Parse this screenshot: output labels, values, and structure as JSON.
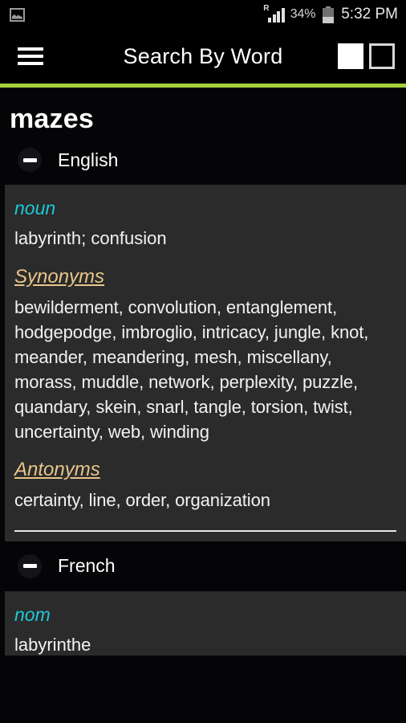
{
  "status_bar": {
    "notification_icon": "image-notification-icon",
    "roaming_indicator": "R",
    "signal_icon": "signal-bars-icon",
    "battery_percent": "34%",
    "battery_icon": "battery-icon",
    "time": "5:32 PM"
  },
  "app_bar": {
    "menu_icon": "hamburger-menu-icon",
    "title": "Search By Word",
    "action_filled": "filled-square-button",
    "action_outline": "outlined-square-button",
    "accent_color": "#a7d13a"
  },
  "entry": {
    "word": "mazes"
  },
  "sections": [
    {
      "language": "English",
      "collapse_icon": "minus-icon",
      "part_of_speech": "noun",
      "definition": "labyrinth; confusion",
      "synonyms_label": "Synonyms",
      "synonyms": "bewilderment, convolution, entanglement, hodgepodge, imbroglio, intricacy, jungle, knot, meander, meandering, mesh, miscellany, morass, muddle, network, perplexity, puzzle, quandary, skein, snarl, tangle, torsion, twist, uncertainty, web, winding",
      "antonyms_label": "Antonyms",
      "antonyms": "certainty, line, order, organization"
    },
    {
      "language": "French",
      "collapse_icon": "minus-icon",
      "part_of_speech": "nom",
      "definition": "labyrinthe"
    }
  ],
  "colors": {
    "page_background": "#050508",
    "card_background": "#2b2b2b",
    "part_of_speech": "#1ec8d8",
    "sub_heading": "#e8c58a",
    "body_text": "#f2f2f2"
  }
}
